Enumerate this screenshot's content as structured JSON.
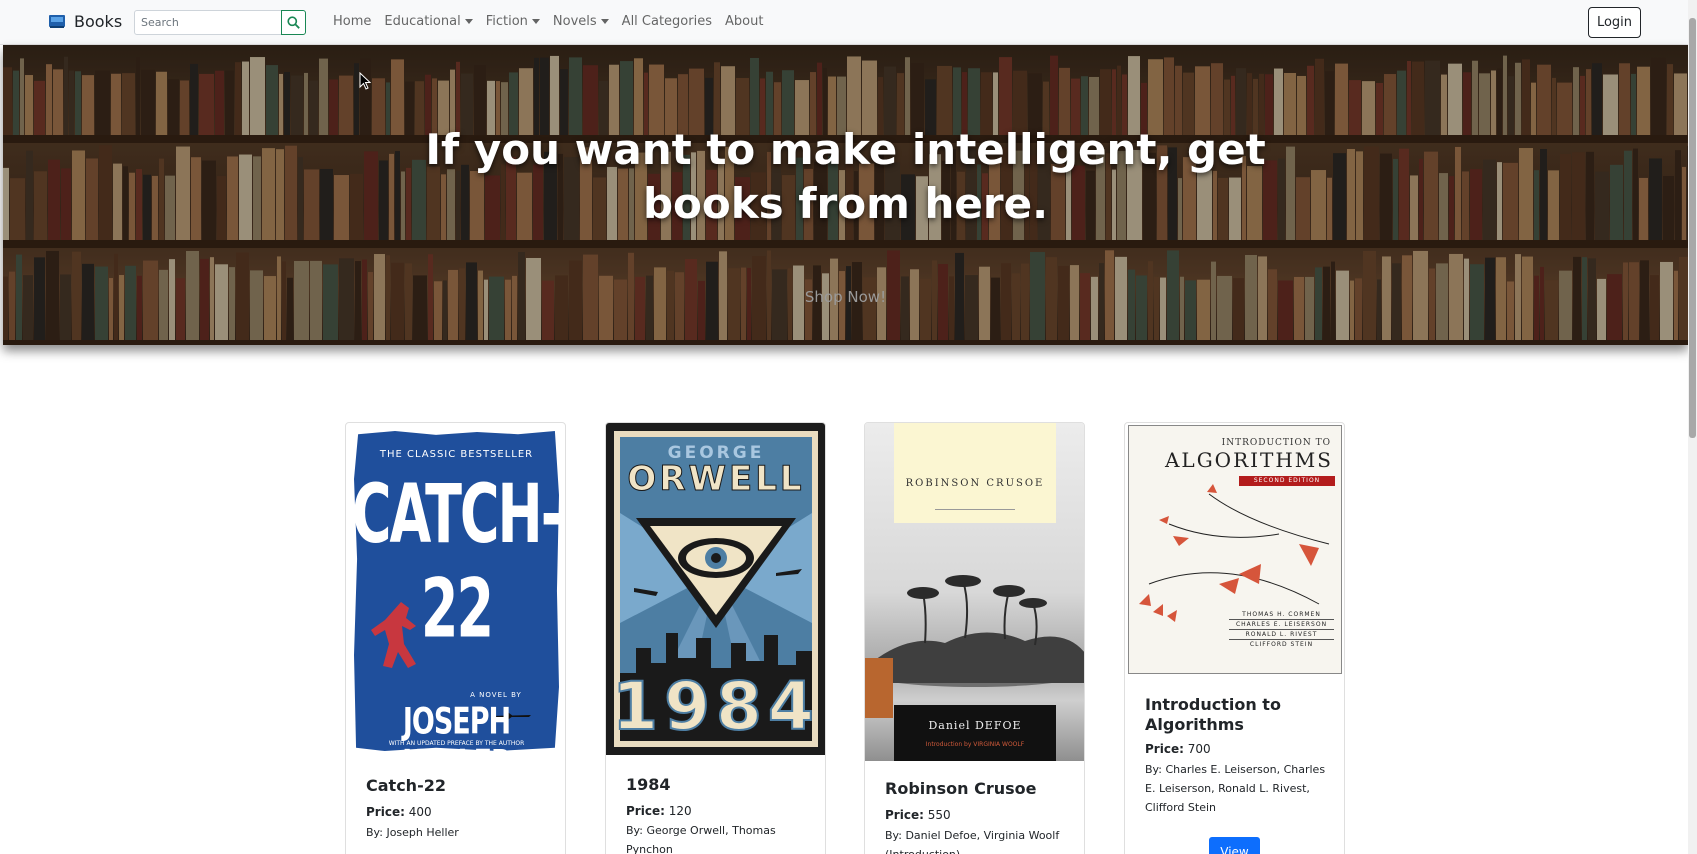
{
  "navbar": {
    "brand": "Books",
    "search_placeholder": "Search",
    "links": [
      {
        "label": "Home",
        "dropdown": false
      },
      {
        "label": "Educational",
        "dropdown": true
      },
      {
        "label": "Fiction",
        "dropdown": true
      },
      {
        "label": "Novels",
        "dropdown": true
      },
      {
        "label": "All Categories",
        "dropdown": false
      },
      {
        "label": "About",
        "dropdown": false
      }
    ],
    "login_label": "Login"
  },
  "hero": {
    "title": "If you want to make intelligent, get books from here.",
    "subtitle": "Shop Now!"
  },
  "books": [
    {
      "title": "Catch-22",
      "price_label": "Price:",
      "price": "400",
      "by": "By: Joseph Heller",
      "cover": {
        "top_text": "THE CLASSIC BESTSELLER",
        "main_text": "CATCH-22",
        "byline": "A NOVEL BY",
        "author": "JOSEPH HELLER",
        "note": "WITH AN UPDATED PREFACE BY THE AUTHOR"
      }
    },
    {
      "title": "1984",
      "price_label": "Price:",
      "price": "120",
      "by": "By: George Orwell, Thomas Pynchon",
      "cover": {
        "author_first": "GEORGE",
        "author_last": "ORWELL",
        "main_text": "1984"
      }
    },
    {
      "title": "Robinson Crusoe",
      "price_label": "Price:",
      "price": "550",
      "by": "By: Daniel Defoe, Virginia Woolf (Introduction)",
      "cover": {
        "main_text": "ROBINSON CRUSOE",
        "author": "Daniel DEFOE",
        "intro": "Introduction by VIRGINIA WOOLF"
      }
    },
    {
      "title": "Introduction to Algorithms",
      "price_label": "Price:",
      "price": "700",
      "by": "By: Charles E. Leiserson, Charles E. Leiserson, Ronald L. Rivest, Clifford Stein",
      "view_label": "View",
      "cover": {
        "line1": "INTRODUCTION TO",
        "line2": "ALGORITHMS",
        "edition": "SECOND EDITION",
        "authors": [
          "THOMAS H. CORMEN",
          "CHARLES E. LEISERSON",
          "RONALD L. RIVEST",
          "CLIFFORD STEIN"
        ]
      }
    }
  ],
  "colors": {
    "primary": "#0d6efd",
    "success": "#198754",
    "navbar_bg": "#f8f9fa",
    "catch22_blue": "#1f4f9c",
    "orwell_blue": "#4d7ea3"
  }
}
